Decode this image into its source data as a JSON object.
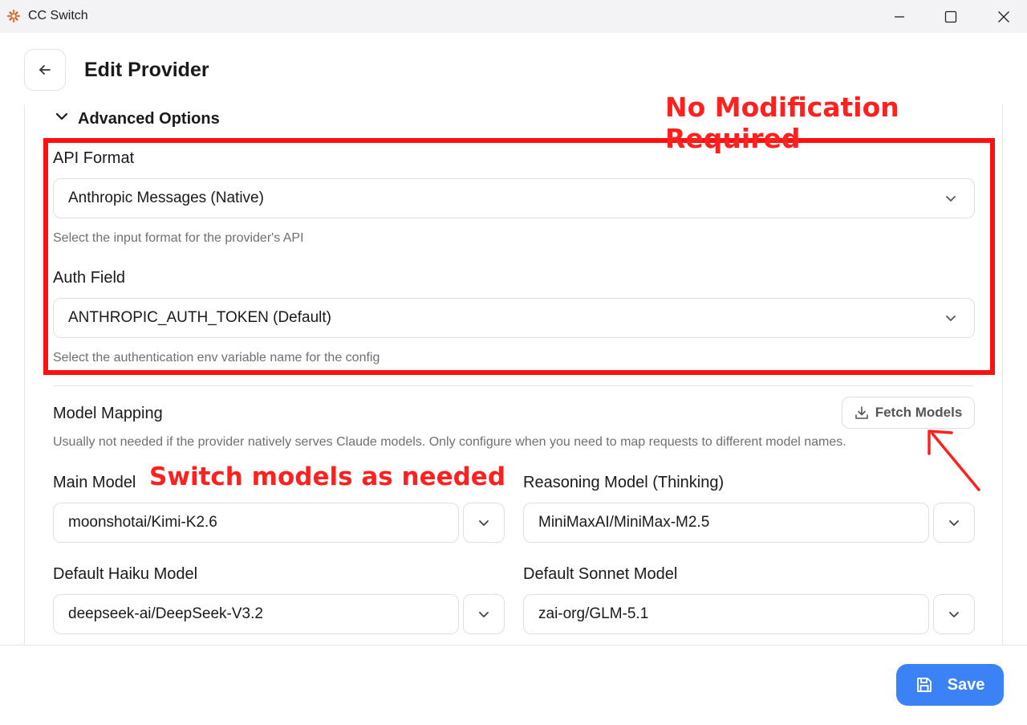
{
  "window": {
    "title": "CC Switch"
  },
  "header": {
    "title": "Edit Provider"
  },
  "advanced": {
    "label": "Advanced Options",
    "api_format": {
      "label": "API Format",
      "value": "Anthropic Messages (Native)",
      "hint": "Select the input format for the provider's API"
    },
    "auth_field": {
      "label": "Auth Field",
      "value": "ANTHROPIC_AUTH_TOKEN (Default)",
      "hint": "Select the authentication env variable name for the config"
    }
  },
  "model_mapping": {
    "label": "Model Mapping",
    "fetch_label": "Fetch Models",
    "hint": "Usually not needed if the provider natively serves Claude models. Only configure when you need to map requests to different model names.",
    "main_model": {
      "label": "Main Model",
      "value": "moonshotai/Kimi-K2.6"
    },
    "reasoning_model": {
      "label": "Reasoning Model (Thinking)",
      "value": "MiniMaxAI/MiniMax-M2.5"
    },
    "haiku_model": {
      "label": "Default Haiku Model",
      "value": "deepseek-ai/DeepSeek-V3.2"
    },
    "sonnet_model": {
      "label": "Default Sonnet Model",
      "value": "zai-org/GLM-5.1"
    }
  },
  "footer": {
    "save_label": "Save"
  },
  "annotations": {
    "no_modification": "No Modification Required",
    "switch_models": "Switch models as needed"
  },
  "colors": {
    "accent": "#3b82f6",
    "annotation": "#ff1010"
  }
}
